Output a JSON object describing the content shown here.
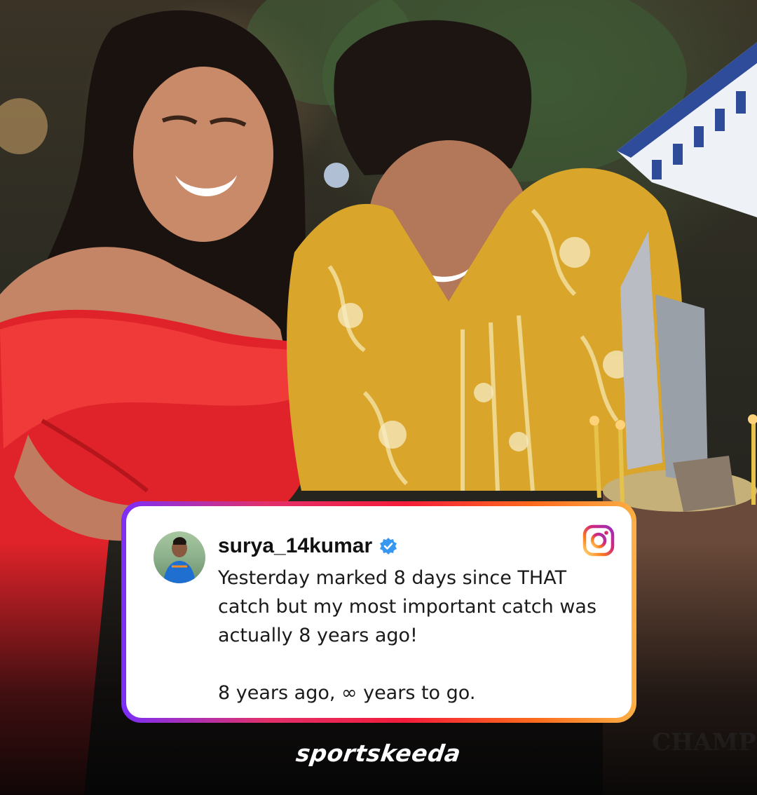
{
  "post": {
    "username": "surya_14kumar",
    "caption_line1": "Yesterday marked 8 days since THAT",
    "caption_line2": "catch but my most important catch was",
    "caption_line3": "actually 8 years ago!",
    "caption_line4": "8 years ago, ∞ years to go."
  },
  "brand": {
    "logo_text": "sportskeeda"
  },
  "icons": {
    "verified": "verified-badge-icon",
    "platform": "instagram-icon"
  },
  "colors": {
    "card_gradient": [
      "#7b2ff7",
      "#e1306c",
      "#f41c3a",
      "#fd6b1d",
      "#fcaf45"
    ],
    "verified_blue": "#3897f0",
    "dress_red": "#e0232a",
    "shirt_gold": "#d9a52a"
  },
  "scene": {
    "cake_topper_text": "CHAMPION"
  }
}
